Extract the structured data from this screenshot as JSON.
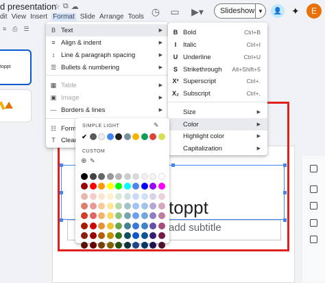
{
  "title": "d presentation",
  "menubar": [
    "dit",
    "View",
    "Insert",
    "Format",
    "Slide",
    "Arrange",
    "Tools"
  ],
  "menubar_active": "Format",
  "toolbar_glyphs": [
    "≡",
    "⎙",
    "☰"
  ],
  "slideshow_label": "Slideshow",
  "avatar_letter": "E",
  "thumb1_text": "toppt",
  "slide": {
    "title": "toppt",
    "subtitle": "add subtitle"
  },
  "format_menu": [
    {
      "icon": "B",
      "label": "Text",
      "arrow": true,
      "highlight": true
    },
    {
      "icon": "≡",
      "label": "Align & indent",
      "arrow": true
    },
    {
      "icon": "↕",
      "label": "Line & paragraph spacing",
      "arrow": true
    },
    {
      "icon": "☰",
      "label": "Bullets & numbering",
      "arrow": true
    },
    {
      "icon": "▦",
      "label": "Table",
      "arrow": true,
      "disabled": true
    },
    {
      "icon": "▣",
      "label": "Image",
      "arrow": true,
      "disabled": true
    },
    {
      "icon": "—",
      "label": "Borders & lines",
      "arrow": true
    },
    {
      "icon": "☷",
      "label": "Forma"
    },
    {
      "icon": "T",
      "label": "Clear f"
    }
  ],
  "text_menu": [
    {
      "icon": "B",
      "label": "Bold",
      "shortcut": "Ctrl+B"
    },
    {
      "icon": "I",
      "label": "Italic",
      "shortcut": "Ctrl+I"
    },
    {
      "icon": "U",
      "label": "Underline",
      "shortcut": "Ctrl+U"
    },
    {
      "icon": "S",
      "label": "Strikethrough",
      "shortcut": "Alt+Shift+5"
    },
    {
      "icon": "X²",
      "label": "Superscript",
      "shortcut": "Ctrl+."
    },
    {
      "icon": "X₂",
      "label": "Subscript",
      "shortcut": "Ctrl+,"
    },
    {
      "label": "Size",
      "arrow": true
    },
    {
      "label": "Color",
      "arrow": true,
      "highlight": true
    },
    {
      "label": "Highlight color",
      "arrow": true
    },
    {
      "label": "Capitalization",
      "arrow": true
    }
  ],
  "color_panel": {
    "theme_label": "SIMPLE LIGHT",
    "custom_label": "CUSTOM",
    "theme_colors": [
      "#000000",
      "#595959",
      "#eeeeee",
      "#4285f4",
      "#212121",
      "#78909c",
      "#f4b400",
      "#0f9d58",
      "#db4437",
      "#d4e157"
    ],
    "grid": [
      [
        "#000000",
        "#434343",
        "#666666",
        "#999999",
        "#b7b7b7",
        "#cccccc",
        "#d9d9d9",
        "#efefef",
        "#f3f3f3",
        "#ffffff"
      ],
      [
        "#980000",
        "#ff0000",
        "#ff9900",
        "#ffff00",
        "#00ff00",
        "#00ffff",
        "#4a86e8",
        "#0000ff",
        "#9900ff",
        "#ff00ff"
      ],
      [
        "#e6b8af",
        "#f4cccc",
        "#fce5cd",
        "#fff2cc",
        "#d9ead3",
        "#d0e0e3",
        "#c9daf8",
        "#cfe2f3",
        "#d9d2e9",
        "#ead1dc"
      ],
      [
        "#dd7e6b",
        "#ea9999",
        "#f9cb9c",
        "#ffe599",
        "#b6d7a8",
        "#a2c4c9",
        "#a4c2f4",
        "#9fc5e8",
        "#b4a7d6",
        "#d5a6bd"
      ],
      [
        "#cc4125",
        "#e06666",
        "#f6b26b",
        "#ffd966",
        "#93c47d",
        "#76a5af",
        "#6d9eeb",
        "#6fa8dc",
        "#8e7cc3",
        "#c27ba0"
      ],
      [
        "#a61c00",
        "#cc0000",
        "#e69138",
        "#f1c232",
        "#6aa84f",
        "#45818e",
        "#3c78d8",
        "#3d85c6",
        "#674ea7",
        "#a64d79"
      ],
      [
        "#85200c",
        "#990000",
        "#b45f06",
        "#bf9000",
        "#38761d",
        "#134f5c",
        "#1155cc",
        "#0b5394",
        "#351c75",
        "#741b47"
      ],
      [
        "#5b0f00",
        "#660000",
        "#783f04",
        "#7f6000",
        "#274e13",
        "#0c343d",
        "#1c4587",
        "#073763",
        "#20124d",
        "#4c1130"
      ]
    ]
  },
  "colors": {
    "accent": "#0b57d0",
    "highlight_box": "#e0201d",
    "selection": "#4285f4"
  }
}
